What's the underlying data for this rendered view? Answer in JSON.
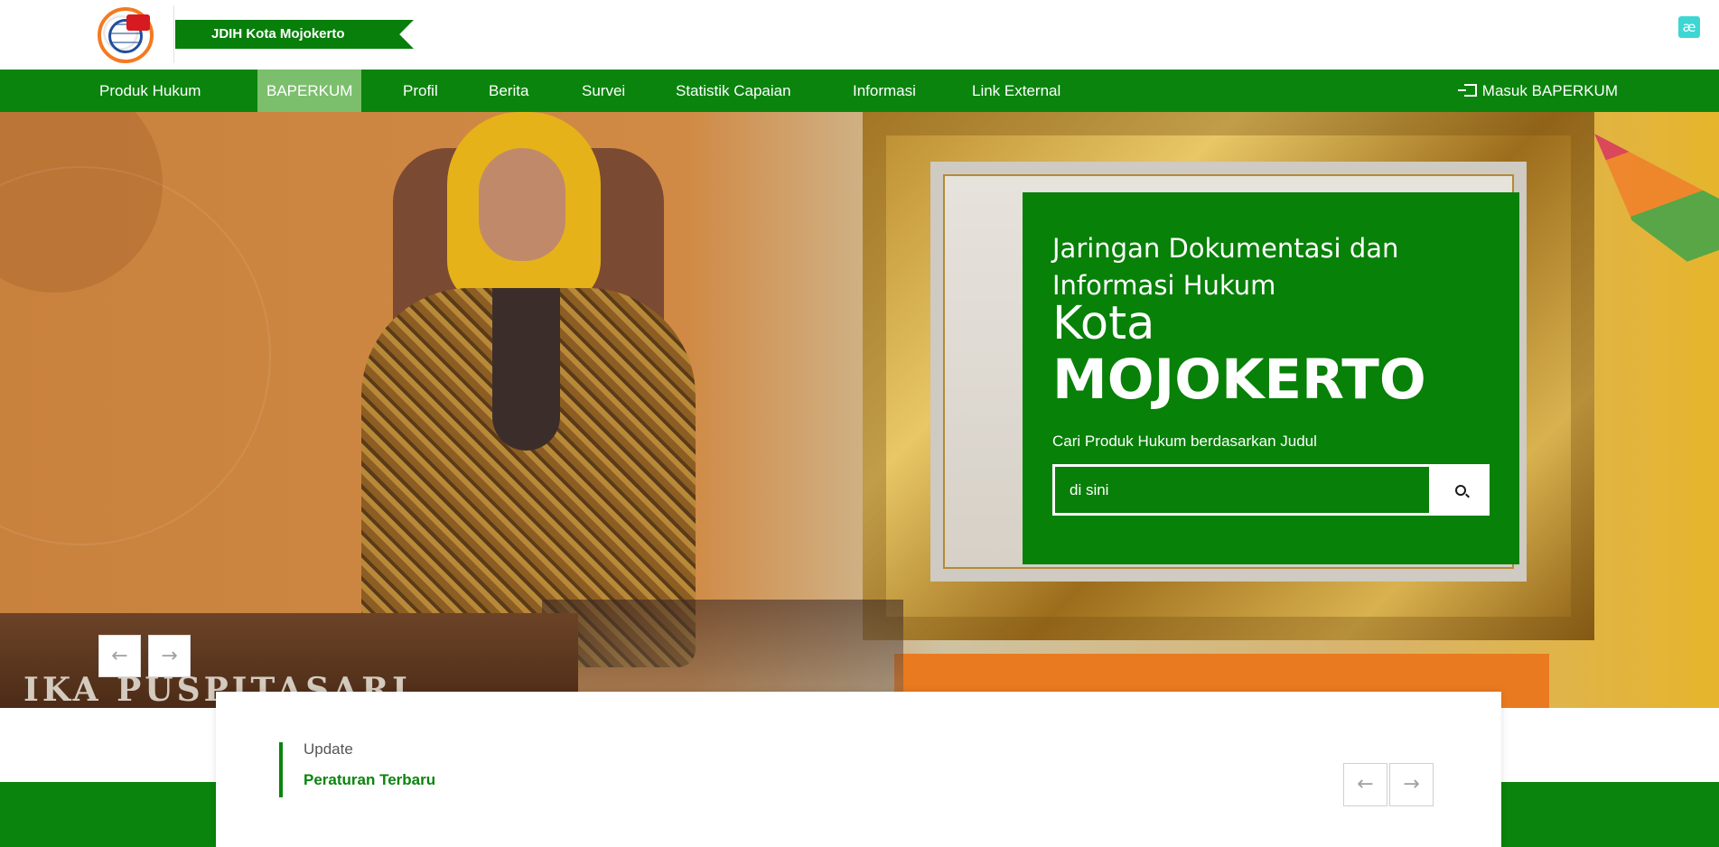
{
  "header": {
    "site_name": "JDIH Kota Mojokerto",
    "ae_badge": "æ",
    "logo_alt": "JDIH"
  },
  "nav": {
    "items": [
      {
        "label": "Produk Hukum",
        "active": false
      },
      {
        "label": "BAPERKUM",
        "active": true
      },
      {
        "label": "Profil",
        "active": false
      },
      {
        "label": "Berita",
        "active": false
      },
      {
        "label": "Survei",
        "active": false
      },
      {
        "label": "Statistik Capaian",
        "active": false
      },
      {
        "label": "Informasi",
        "active": false
      },
      {
        "label": "Link External",
        "active": false
      }
    ],
    "login_label": "Masuk BAPERKUM",
    "login_icon": "sign-in-icon"
  },
  "hero": {
    "subtitle": "Jaringan Dokumentasi dan Informasi Hukum",
    "city_prefix": "Kota",
    "city_name": "MOJOKERTO",
    "search_label": "Cari Produk Hukum berdasarkan Judul",
    "search_placeholder": "di sini",
    "search_icon": "search-icon",
    "nameplate": "IKA PUSPITASARI",
    "prev_arrow": "←",
    "next_arrow": "→"
  },
  "update": {
    "label": "Update",
    "title": "Peraturan Terbaru",
    "prev_arrow": "←",
    "next_arrow": "→"
  },
  "colors": {
    "brand_green": "#0a840d",
    "nav_active": "#7bbf6c",
    "panel_green": "#078107"
  }
}
